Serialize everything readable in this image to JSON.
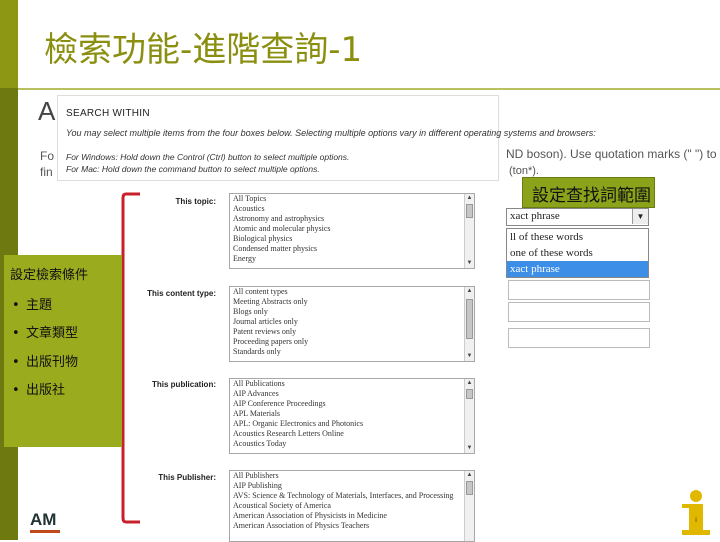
{
  "slide": {
    "title": "檢索功能-進階查詢-1"
  },
  "background_fragments": {
    "big_letter": "A",
    "fo1": "Fo",
    "fo2": "fin",
    "nd_text": "ND boson). Use quotation marks (\" \") to",
    "on_text": "(ton*)."
  },
  "search_within": {
    "title": "SEARCH WITHIN",
    "description": "You may select multiple items from the four boxes below. Selecting multiple options vary in different operating systems and browsers:",
    "windows_hint": "For Windows: Hold down the Control (Ctrl) button to select multiple options.",
    "mac_hint": "For Mac: Hold down the command button to select multiple options."
  },
  "filters": {
    "topic": {
      "label": "This topic:",
      "options": [
        "All Topics",
        "Acoustics",
        "Astronomy and astrophysics",
        "Atomic and molecular physics",
        "Biological physics",
        "Condensed matter physics",
        "Energy"
      ]
    },
    "content_type": {
      "label": "This content type:",
      "options": [
        "All content types",
        "Meeting Abstracts only",
        "Blogs only",
        "Journal articles only",
        "Patent reviews only",
        "Proceeding papers only",
        "Standards only"
      ]
    },
    "publication": {
      "label": "This publication:",
      "options": [
        "All Publications",
        "AIP Advances",
        "AIP Conference Proceedings",
        "APL Materials",
        "APL: Organic Electronics and Photonics",
        "Acoustics Research Letters Online",
        "Acoustics Today"
      ]
    },
    "publisher": {
      "label": "This Publisher:",
      "options": [
        "All Publishers",
        "AIP Publishing",
        "AVS: Science & Technology of Materials, Interfaces, and Processing",
        "Acoustical Society of America",
        "American Association of Physicists in Medicine",
        "American Association of Physics Teachers"
      ]
    }
  },
  "conditions_panel": {
    "title": "設定檢索條件",
    "items": [
      "主題",
      "文章類型",
      "出版刊物",
      "出版社"
    ],
    "bullet": "•"
  },
  "range_callout": {
    "text": "設定查找詞範圍"
  },
  "phrase_select": {
    "value": "xact phrase",
    "arrow": "▼",
    "options": [
      "ll of these words",
      "one of these words",
      "xact phrase"
    ],
    "highlight_color": "#3c8ee6"
  },
  "logos": {
    "bottom_left": "AM",
    "info_letter": "i"
  },
  "colors": {
    "olive": "#8d9713",
    "panel_green": "#9aab1e",
    "callout_green": "#8aa31a",
    "bracket_red": "#c8202a",
    "info_yellow": "#e0b800"
  }
}
